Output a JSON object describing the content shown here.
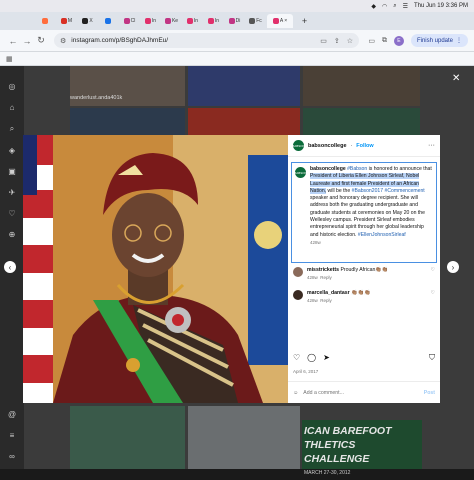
{
  "system": {
    "clock": "Thu Jun 19  3:36 PM"
  },
  "browser": {
    "tabs": [
      {
        "label": "",
        "color": "#ff6d3d"
      },
      {
        "label": "M",
        "color": "#d93025"
      },
      {
        "label": "X",
        "color": "#222222"
      },
      {
        "label": "",
        "color": "#1a73e8"
      },
      {
        "label": "Cl",
        "color": "#c13584"
      },
      {
        "label": "In",
        "color": "#e1306c"
      },
      {
        "label": "Ke",
        "color": "#c13584"
      },
      {
        "label": "In",
        "color": "#e1306c"
      },
      {
        "label": "In",
        "color": "#e1306c"
      },
      {
        "label": "Di",
        "color": "#c13584"
      },
      {
        "label": "Fc",
        "color": "#555555"
      },
      {
        "label": "A",
        "color": "#e1306c"
      }
    ],
    "active_tab_close": "×",
    "new_tab": "+",
    "url": "instagram.com/p/BSghDAJhmEu/",
    "update_button": "Finish update",
    "profile_initial": "E"
  },
  "background": {
    "caption": "wanderlust.anda401k"
  },
  "post": {
    "username": "babsoncollege",
    "follow_label": "Follow",
    "logo_text": "BABSON",
    "caption": {
      "username": "babsoncollege",
      "parts": [
        {
          "text": " ",
          "type": "plain"
        },
        {
          "text": "#Babson",
          "type": "tag"
        },
        {
          "text": " is honored to announce that ",
          "type": "plain"
        },
        {
          "text": "President of Liberia Ellen Johnson Sirleaf, Nobel Laureate and first female President of an African Nation,",
          "type": "highlight"
        },
        {
          "text": " will be the ",
          "type": "plain"
        },
        {
          "text": "#Babson2017",
          "type": "tag"
        },
        {
          "text": " ",
          "type": "plain"
        },
        {
          "text": "#Commencement",
          "type": "tag"
        },
        {
          "text": " speaker and honorary degree recipient. She will address both the graduating undergraduate and graduate students at ceremonies on May 20 on the Wellesley campus. President Sirleaf embodies entrepreneurial spirit through her global leadership and historic election. ",
          "type": "plain"
        },
        {
          "text": "#EllenJohnsonSirleaf",
          "type": "tag"
        }
      ],
      "age": "428w"
    },
    "comments": [
      {
        "username": "misstricketts",
        "text": "Proudly African👏🏽👏🏽",
        "age": "428w",
        "reply": "Reply",
        "avatar_color": "#8a6a5a"
      },
      {
        "username": "marcella_dantasr",
        "text": "👏🏽👏🏽👏🏽",
        "age": "428w",
        "reply": "Reply",
        "avatar_color": "#3a2a22"
      }
    ],
    "date": "April 6, 2017",
    "add_comment_placeholder": "Add a comment...",
    "post_label": "Post"
  },
  "bottom_banner": {
    "line1": "ICAN BAREFOOT",
    "line2": "THLETICS CHALLENGE",
    "line3": "MARCH 27-30, 2012"
  }
}
